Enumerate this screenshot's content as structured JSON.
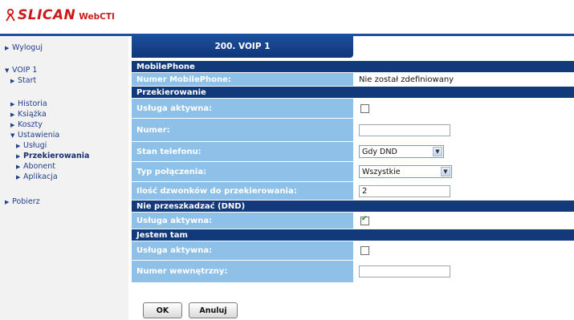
{
  "brand": {
    "name": "SLICAN",
    "product": "WebCTI",
    "color": "#cc1a1a"
  },
  "sidebar": {
    "items": [
      {
        "label": "Wyloguj",
        "icon": "triangle-right-icon"
      },
      {
        "label": "VOIP 1",
        "icon": "triangle-down-icon"
      },
      {
        "label": "Start",
        "icon": "triangle-right-icon"
      },
      {
        "label": "Historia",
        "icon": "triangle-right-icon"
      },
      {
        "label": "Książka",
        "icon": "triangle-right-icon"
      },
      {
        "label": "Koszty",
        "icon": "triangle-right-icon"
      },
      {
        "label": "Ustawienia",
        "icon": "triangle-down-icon"
      },
      {
        "label": "Usługi",
        "icon": "triangle-right-icon"
      },
      {
        "label": "Przekierowania",
        "icon": "triangle-right-icon",
        "active": true
      },
      {
        "label": "Abonent",
        "icon": "triangle-right-icon"
      },
      {
        "label": "Aplikacja",
        "icon": "triangle-right-icon"
      },
      {
        "label": "Pobierz",
        "icon": "triangle-right-icon"
      }
    ]
  },
  "header": {
    "tab_label": "200. VOIP 1"
  },
  "sections": {
    "mobile": {
      "title": "MobilePhone",
      "number_label": "Numer MobilePhone:",
      "number_value": "Nie został zdefiniowany"
    },
    "forward": {
      "title": "Przekierowanie",
      "active_label": "Usługa aktywna:",
      "active_checked": false,
      "number_label": "Numer:",
      "number_value": "",
      "state_label": "Stan telefonu:",
      "state_value": "Gdy DND",
      "type_label": "Typ połączenia:",
      "type_value": "Wszystkie",
      "rings_label": "Ilość dzwonków do przekierowania:",
      "rings_value": "2"
    },
    "dnd": {
      "title": "Nie przeszkadzać (DND)",
      "active_label": "Usługa aktywna:",
      "active_checked": true
    },
    "jestem": {
      "title": "Jestem tam",
      "active_label": "Usługa aktywna:",
      "active_checked": false,
      "internal_label": "Numer wewnętrzny:",
      "internal_value": ""
    }
  },
  "buttons": {
    "ok": "OK",
    "cancel": "Anuluj"
  },
  "colors": {
    "section_bg": "#12397a",
    "label_bg": "#8ec0e8",
    "nav_text": "#1e3f8a"
  }
}
